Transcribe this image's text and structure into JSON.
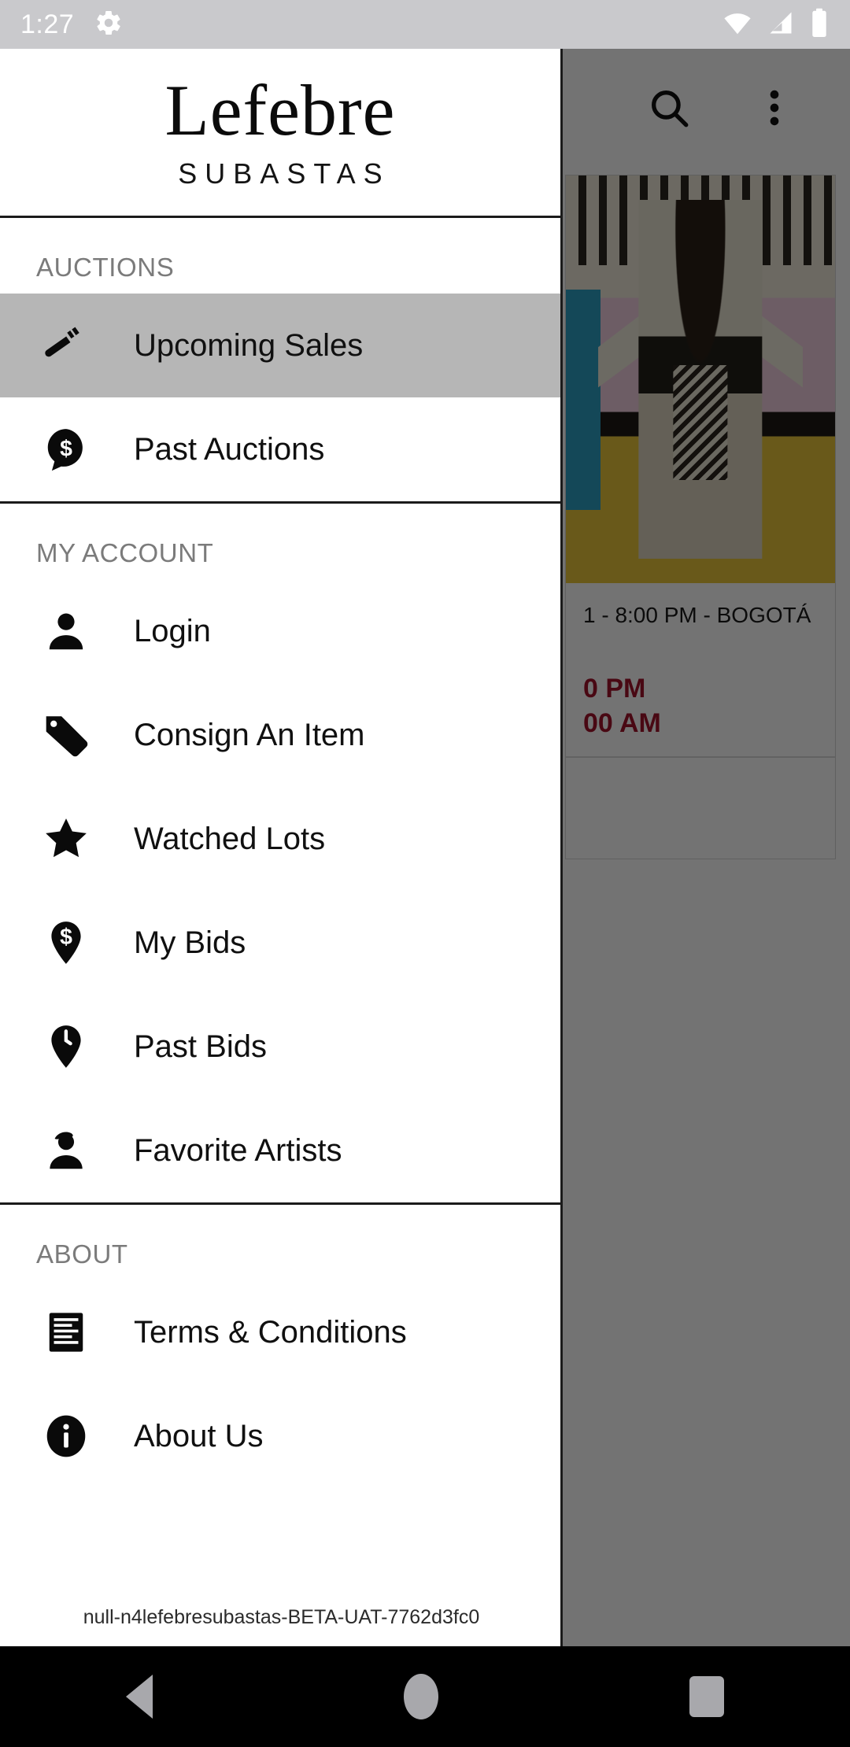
{
  "status_bar": {
    "clock": "1:27",
    "icons": [
      "gear-icon",
      "wifi-icon",
      "cellular-signal-icon",
      "battery-icon"
    ]
  },
  "app_bar": {
    "search_icon": "search-icon",
    "overflow_icon": "more-vertical-icon"
  },
  "background_content": {
    "card": {
      "artwork_alt": "pop-art woman standing in front of cars",
      "date_line": "1 - 8:00 PM - BOGOTÁ",
      "time_pm": "0 PM",
      "time_am": "00 AM"
    }
  },
  "drawer": {
    "logo": {
      "word": "Lefebre",
      "subtitle": "SUBASTAS"
    },
    "sections": [
      {
        "title": "AUCTIONS",
        "items": [
          {
            "label": "Upcoming Sales",
            "icon": "gavel-icon",
            "active": true
          },
          {
            "label": "Past Auctions",
            "icon": "dollar-speech-bubble-icon",
            "active": false
          }
        ]
      },
      {
        "title": "MY ACCOUNT",
        "items": [
          {
            "label": "Login",
            "icon": "person-icon",
            "active": false
          },
          {
            "label": "Consign An Item",
            "icon": "tag-icon",
            "active": false
          },
          {
            "label": "Watched Lots",
            "icon": "star-icon",
            "active": false
          },
          {
            "label": "My Bids",
            "icon": "dollar-pin-icon",
            "active": false
          },
          {
            "label": "Past Bids",
            "icon": "clock-pin-icon",
            "active": false
          },
          {
            "label": "Favorite Artists",
            "icon": "artist-person-icon",
            "active": false
          }
        ]
      },
      {
        "title": "ABOUT",
        "items": [
          {
            "label": "Terms & Conditions",
            "icon": "document-lines-icon",
            "active": false
          },
          {
            "label": "About Us",
            "icon": "info-circle-icon",
            "active": false
          }
        ]
      }
    ],
    "build_id": "null-n4lefebresubastas-BETA-UAT-7762d3fc0"
  },
  "navigation_bar": {
    "back": "back-triangle-icon",
    "home": "home-circle-icon",
    "recents": "recents-square-icon"
  },
  "colors": {
    "accent_red": "#a3122c",
    "active_item_bg": "#b6b6b6",
    "status_bar_bg": "#c9c9cc",
    "section_title": "#7b7b7b"
  }
}
